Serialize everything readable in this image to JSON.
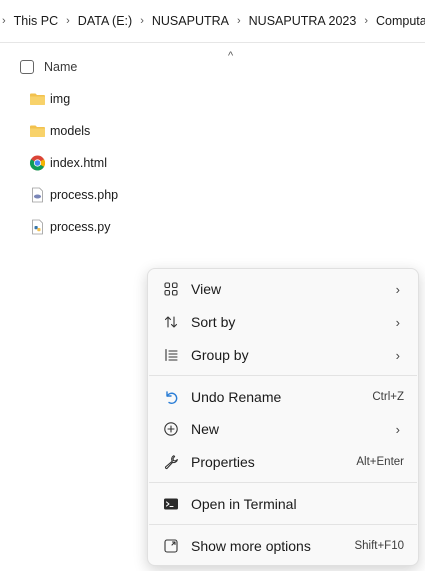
{
  "breadcrumb": {
    "items": [
      "This PC",
      "DATA (E:)",
      "NUSAPUTRA",
      "NUSAPUTRA 2023",
      "Computatio"
    ],
    "separator": "›"
  },
  "column_header": {
    "name_label": "Name",
    "sort_indicator": "^"
  },
  "files": [
    {
      "name": "img",
      "icon": "folder-icon"
    },
    {
      "name": "models",
      "icon": "folder-icon"
    },
    {
      "name": "index.html",
      "icon": "chrome-icon"
    },
    {
      "name": "process.php",
      "icon": "php-file-icon"
    },
    {
      "name": "process.py",
      "icon": "python-file-icon"
    }
  ],
  "context_menu": {
    "view": {
      "label": "View",
      "icon": "grid-view-icon"
    },
    "sort_by": {
      "label": "Sort by",
      "icon": "sort-icon"
    },
    "group_by": {
      "label": "Group by",
      "icon": "group-list-icon"
    },
    "undo_rename": {
      "label": "Undo Rename",
      "shortcut": "Ctrl+Z",
      "icon": "undo-icon"
    },
    "new": {
      "label": "New",
      "icon": "plus-circle-icon"
    },
    "properties": {
      "label": "Properties",
      "shortcut": "Alt+Enter",
      "icon": "wrench-icon"
    },
    "open_terminal": {
      "label": "Open in Terminal",
      "icon": "terminal-icon"
    },
    "show_more": {
      "label": "Show more options",
      "shortcut": "Shift+F10",
      "icon": "expand-icon"
    },
    "chevron": "›"
  },
  "colors": {
    "folder": "#F2C14E",
    "accent_blue": "#2A7DD6",
    "menu_background": "#F9F9F9"
  }
}
